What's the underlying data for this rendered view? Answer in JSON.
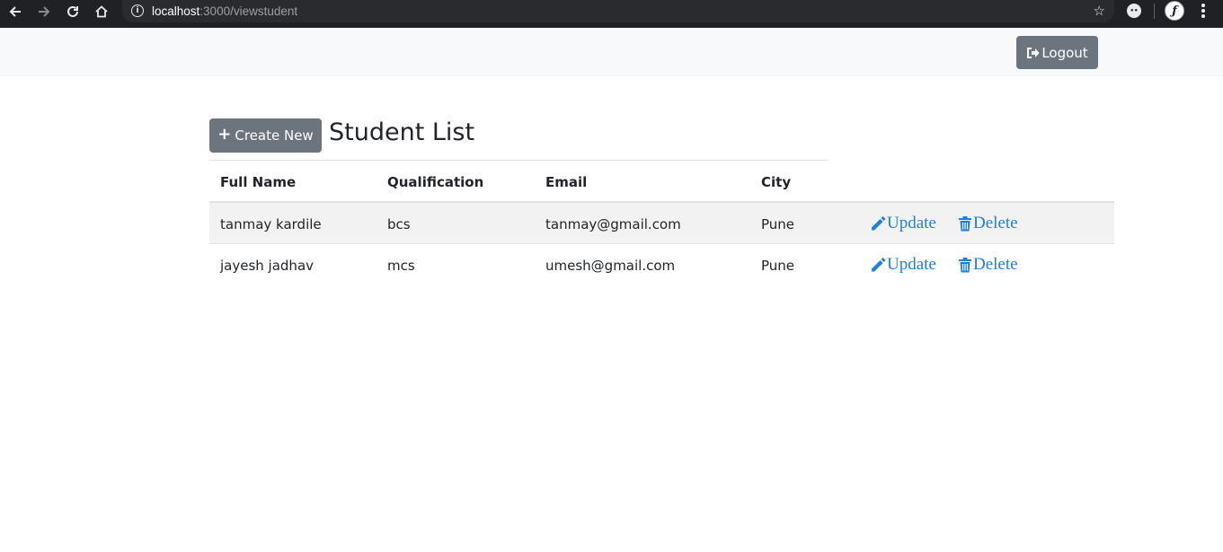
{
  "browser": {
    "url_host": "localhost",
    "url_path": ":3000/viewstudent"
  },
  "navbar": {
    "logout_label": "Logout"
  },
  "page": {
    "create_label": "Create New",
    "title": "Student List"
  },
  "table": {
    "headers": [
      "Full Name",
      "Qualification",
      "Email",
      "City"
    ],
    "rows": [
      {
        "name": "tanmay kardile",
        "qualification": "bcs",
        "email": "tanmay@gmail.com",
        "city": "Pune",
        "update_label": "Update",
        "delete_label": "Delete"
      },
      {
        "name": "jayesh jadhav",
        "qualification": "mcs",
        "email": "umesh@gmail.com",
        "city": "Pune",
        "update_label": "Update",
        "delete_label": "Delete"
      }
    ]
  },
  "colors": {
    "secondary_button": "#6c757d",
    "link_blue": "#1e7fe0",
    "navbar_bg": "#f8f9fa",
    "striped_row": "#f2f2f2"
  }
}
